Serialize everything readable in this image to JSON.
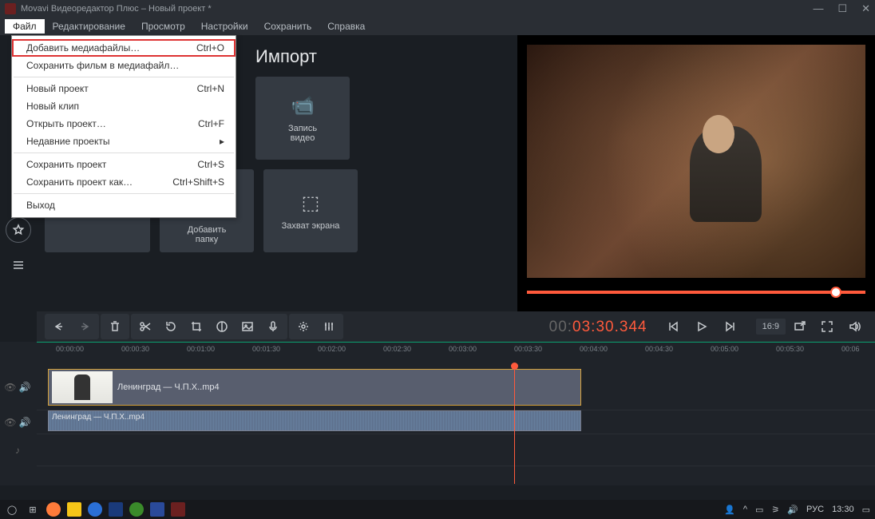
{
  "title": "Movavi Видеоредактор Плюс – Новый проект *",
  "menubar": [
    "Файл",
    "Редактирование",
    "Просмотр",
    "Настройки",
    "Сохранить",
    "Справка"
  ],
  "dropdown": {
    "add_media": {
      "label": "Добавить медиафайлы…",
      "sc": "Ctrl+O"
    },
    "save_movie": {
      "label": "Сохранить фильм в медиафайл…",
      "sc": ""
    },
    "new_project": {
      "label": "Новый проект",
      "sc": "Ctrl+N"
    },
    "new_clip": {
      "label": "Новый клип",
      "sc": ""
    },
    "open_project": {
      "label": "Открыть проект…",
      "sc": "Ctrl+F"
    },
    "recent": {
      "label": "Недавние проекты",
      "sc": "▸"
    },
    "save_project": {
      "label": "Сохранить проект",
      "sc": "Ctrl+S"
    },
    "save_project_as": {
      "label": "Сохранить проект как…",
      "sc": "Ctrl+Shift+S"
    },
    "exit": {
      "label": "Выход",
      "sc": ""
    }
  },
  "import_heading": "Импорт",
  "cards": {
    "record_video": "Запись\nвидео",
    "add_folder": "Добавить\nпапку",
    "screen_capture": "Захват экрана"
  },
  "timecode": {
    "gray": "00:",
    "red": "03:30.344"
  },
  "aspect": "16:9",
  "ruler": [
    "00:00:00",
    "00:00:30",
    "00:01:00",
    "00:01:30",
    "00:02:00",
    "00:02:30",
    "00:03:00",
    "00:03:30",
    "00:04:00",
    "00:04:30",
    "00:05:00",
    "00:05:30",
    "00:06"
  ],
  "clip_name": "Ленинград — Ч.П.Х..mp4",
  "audio_name": "Ленинград — Ч.П.Х..mp4",
  "taskbar": {
    "lang": "РУС",
    "time": "13:30"
  }
}
